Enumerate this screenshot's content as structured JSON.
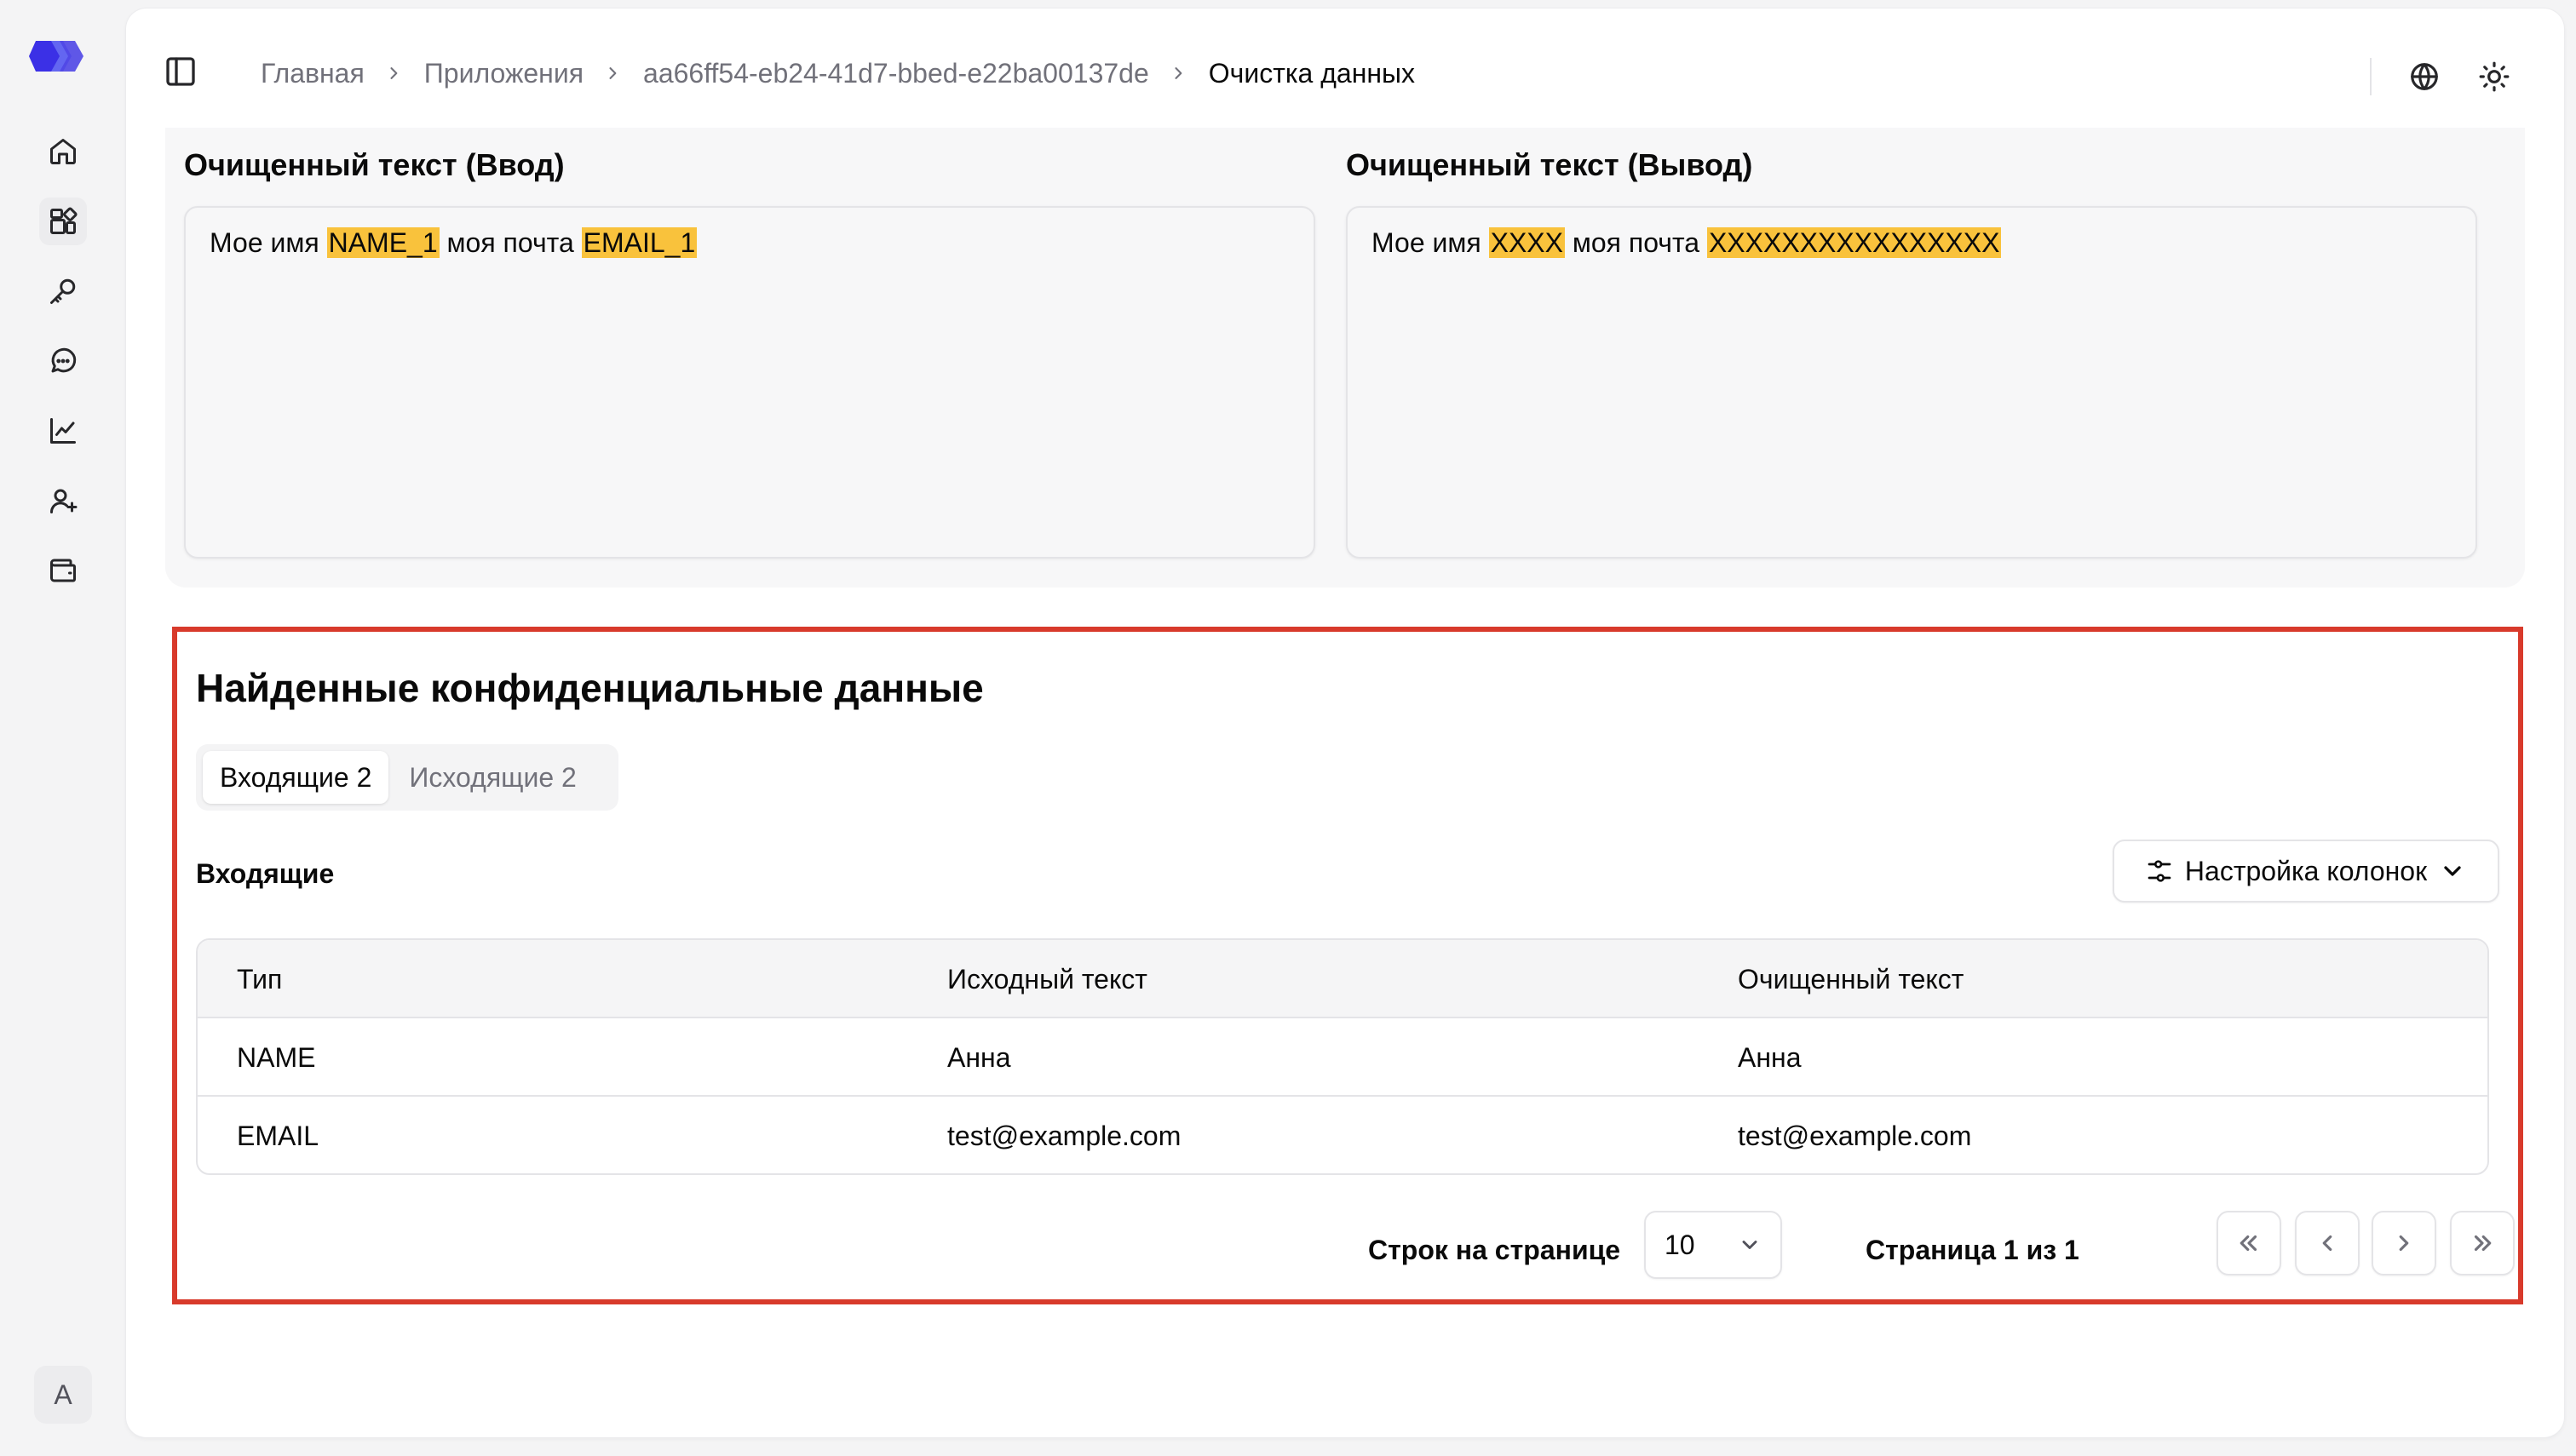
{
  "breadcrumb": {
    "home": "Главная",
    "apps": "Приложения",
    "app_id": "aa66ff54-eb24-41d7-bbed-e22ba00137de",
    "current": "Очистка данных"
  },
  "sidebar": {
    "items": [
      "home-icon",
      "apps-icon",
      "key-icon",
      "chat-icon",
      "chart-icon",
      "add-user-icon",
      "wallet-icon"
    ],
    "avatar_letter": "A"
  },
  "input_panel": {
    "title": "Очищенный текст (Ввод)",
    "text_before_1": "Мое имя ",
    "token_1": "NAME_1",
    "text_between": " моя почта ",
    "token_2": "EMAIL_1"
  },
  "output_panel": {
    "title": "Очищенный текст (Вывод)",
    "text_before_1": "Мое имя ",
    "token_1": "XXXX",
    "text_between": " моя почта ",
    "token_2": "XXXXXXXXXXXXXXXX"
  },
  "found": {
    "title": "Найденные конфиденциальные данные",
    "tabs": [
      {
        "label": "Входящие 2",
        "active": true
      },
      {
        "label": "Исходящие 2",
        "active": false
      }
    ],
    "section_title": "Входящие",
    "columns_button": "Настройка колонок",
    "table": {
      "headers": [
        "Тип",
        "Исходный текст",
        "Очищенный текст"
      ],
      "rows": [
        [
          "NAME",
          "Анна",
          "Анна"
        ],
        [
          "EMAIL",
          "test@example.com",
          "test@example.com"
        ]
      ]
    },
    "pagination": {
      "rows_label": "Строк на странице",
      "rows_value": "10",
      "page_info": "Страница 1 из 1"
    }
  },
  "colors": {
    "highlight": "#f9c23c",
    "frame": "#d83a2b",
    "logo": "#4f46e5"
  }
}
